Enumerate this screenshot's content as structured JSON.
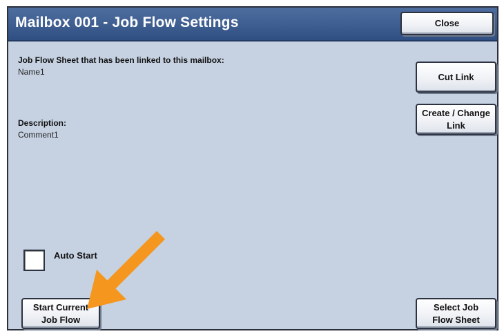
{
  "window": {
    "title": "Mailbox 001 - Job Flow Settings"
  },
  "buttons": {
    "close": "Close",
    "cut_link": "Cut Link",
    "create_change_link_line1": "Create / Change",
    "create_change_link_line2": "Link",
    "start_current_line1": "Start Current",
    "start_current_line2": "Job Flow",
    "select_sheet_line1": "Select Job",
    "select_sheet_line2": "Flow Sheet"
  },
  "linked_sheet": {
    "label": "Job Flow Sheet that has been linked to this mailbox:",
    "value": "Name1"
  },
  "description": {
    "label": "Description:",
    "value": "Comment1"
  },
  "auto_start": {
    "label": "Auto Start",
    "checked": false
  },
  "colors": {
    "titlebar": "#3a5a8c",
    "background": "#c6d2e2",
    "arrow": "#f5961e"
  },
  "icons": {
    "annotation_arrow": "arrow-down-left-icon"
  }
}
